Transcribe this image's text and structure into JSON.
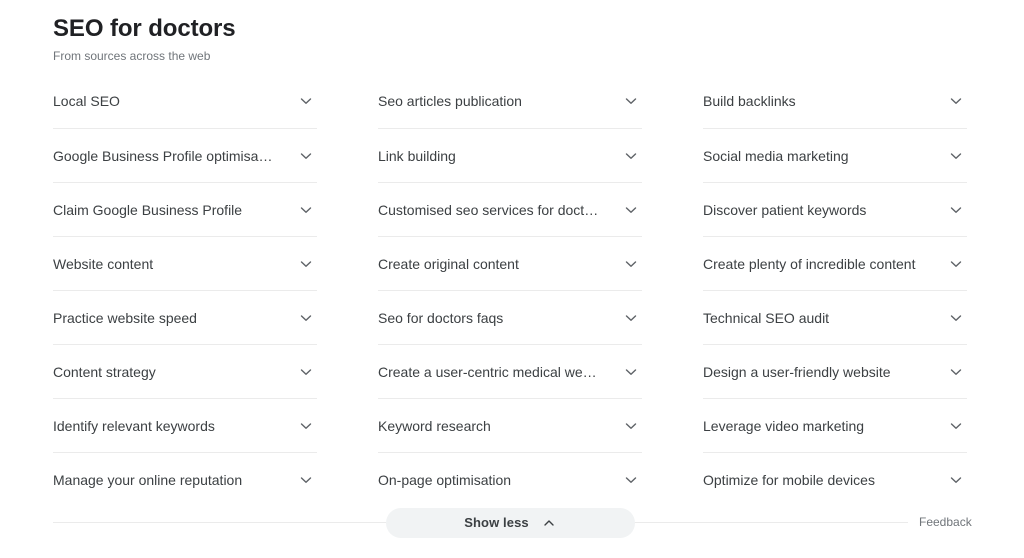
{
  "header": {
    "title": "SEO for doctors",
    "subtitle": "From sources across the web"
  },
  "columns": [
    {
      "items": [
        {
          "label": "Local SEO",
          "icon": "chevron-down-icon"
        },
        {
          "label": "Google Business Profile optimisation",
          "icon": "chevron-down-icon"
        },
        {
          "label": "Claim Google Business Profile",
          "icon": "chevron-down-icon"
        },
        {
          "label": "Website content",
          "icon": "chevron-down-icon"
        },
        {
          "label": "Practice website speed",
          "icon": "chevron-down-icon"
        },
        {
          "label": "Content strategy",
          "icon": "chevron-down-icon"
        },
        {
          "label": "Identify relevant keywords",
          "icon": "chevron-down-icon"
        },
        {
          "label": "Manage your online reputation",
          "icon": "chevron-down-icon"
        }
      ]
    },
    {
      "items": [
        {
          "label": "Seo articles publication",
          "icon": "chevron-down-icon"
        },
        {
          "label": "Link building",
          "icon": "chevron-down-icon"
        },
        {
          "label": "Customised seo services for doctors",
          "icon": "chevron-down-icon"
        },
        {
          "label": "Create original content",
          "icon": "chevron-down-icon"
        },
        {
          "label": "Seo for doctors faqs",
          "icon": "chevron-down-icon"
        },
        {
          "label": "Create a user-centric medical web…",
          "icon": "chevron-down-icon"
        },
        {
          "label": "Keyword research",
          "icon": "chevron-down-icon"
        },
        {
          "label": "On-page optimisation",
          "icon": "chevron-down-icon"
        }
      ]
    },
    {
      "items": [
        {
          "label": "Build backlinks",
          "icon": "chevron-down-icon"
        },
        {
          "label": "Social media marketing",
          "icon": "chevron-down-icon"
        },
        {
          "label": "Discover patient keywords",
          "icon": "chevron-down-icon"
        },
        {
          "label": "Create plenty of incredible content",
          "icon": "chevron-down-icon"
        },
        {
          "label": "Technical SEO audit",
          "icon": "chevron-down-icon"
        },
        {
          "label": "Design a user-friendly website",
          "icon": "chevron-down-icon"
        },
        {
          "label": "Leverage video marketing",
          "icon": "chevron-down-icon"
        },
        {
          "label": "Optimize for mobile devices",
          "icon": "chevron-down-icon"
        }
      ]
    }
  ],
  "footer": {
    "show_less_label": "Show less",
    "show_less_icon": "chevron-up-icon",
    "feedback_label": "Feedback"
  },
  "colors": {
    "background": "#ffffff",
    "title_text": "#202124",
    "item_text": "#3c4043",
    "muted_text": "#70757a",
    "divider": "#ebebeb",
    "button_fill": "#f1f3f4",
    "icon_stroke": "#5f6368"
  }
}
